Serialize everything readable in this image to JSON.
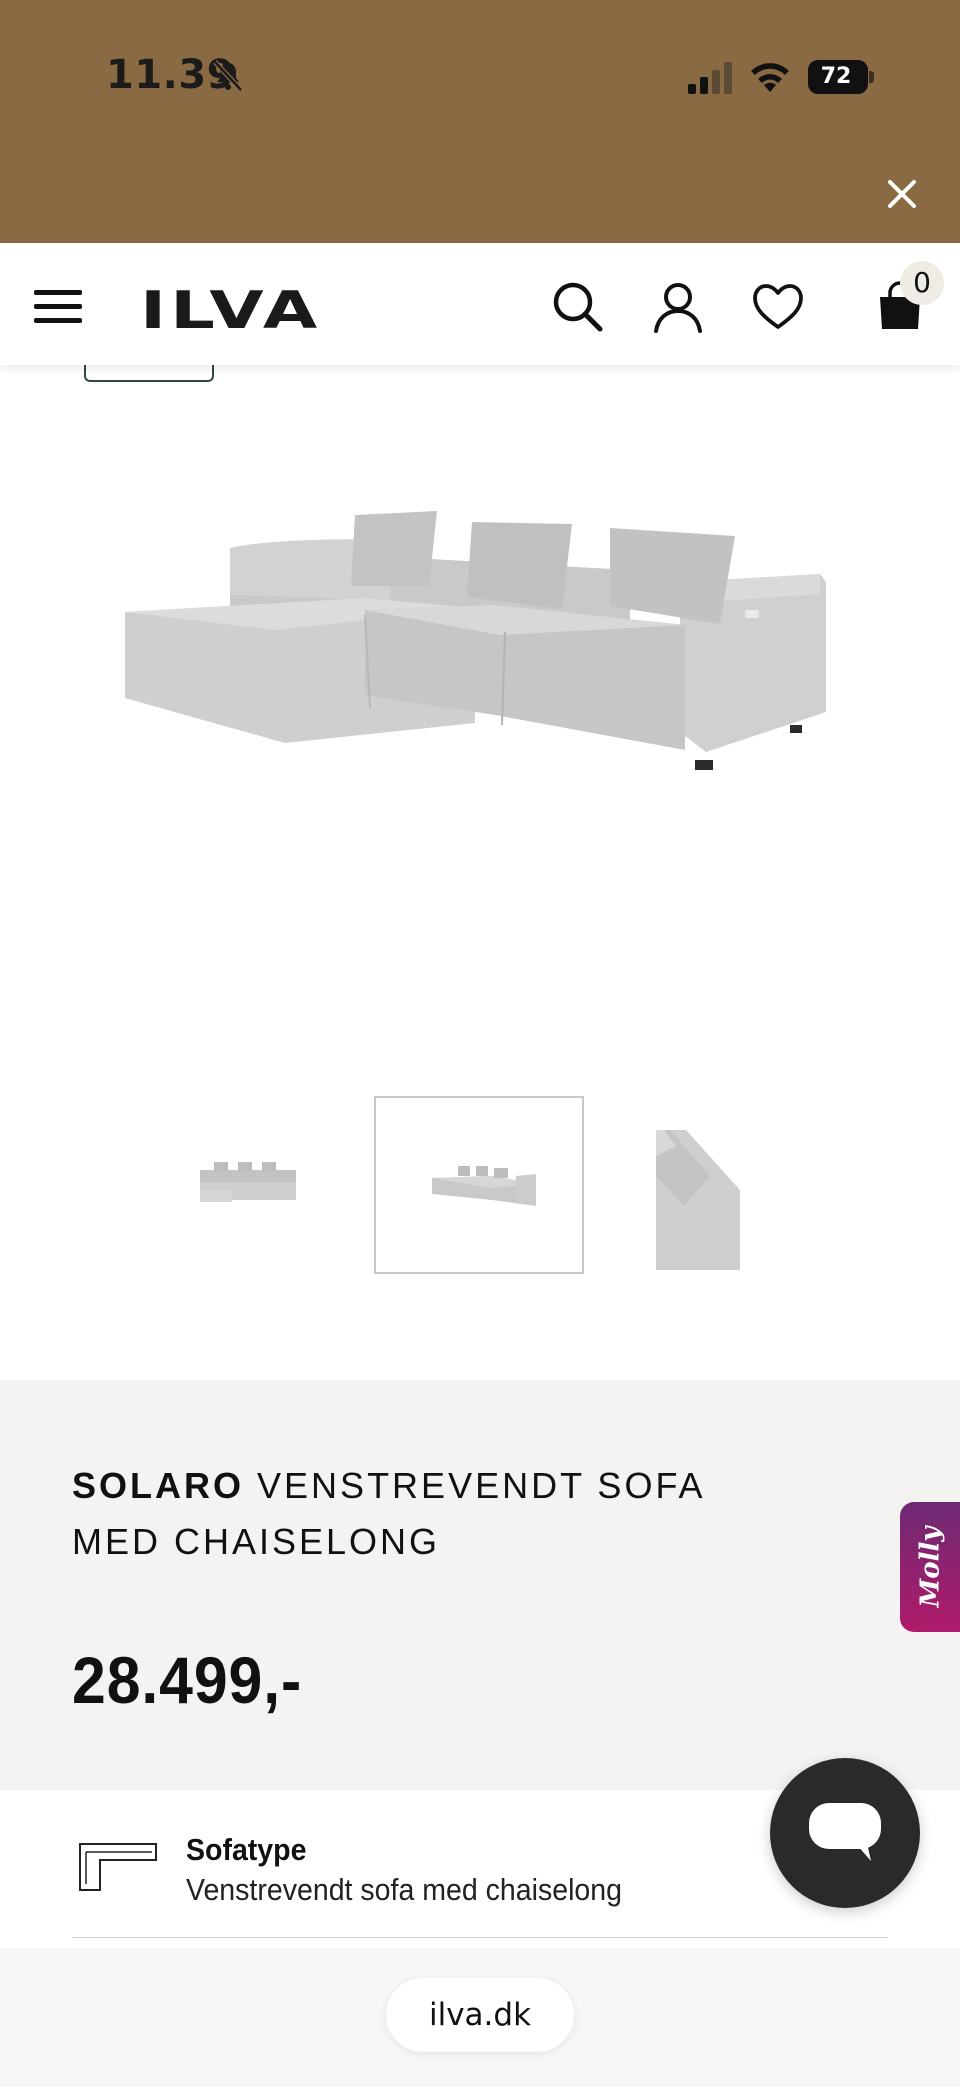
{
  "status_bar": {
    "time": "11.39",
    "battery": "72",
    "icons": [
      "bell-muted-icon",
      "signal-icon",
      "wifi-icon",
      "battery-icon"
    ]
  },
  "banner": {
    "background": "#8a6a43",
    "close_icon": "close-icon"
  },
  "header": {
    "logo": "ILVA",
    "icons": [
      "menu-icon",
      "search-icon",
      "user-icon",
      "heart-icon",
      "bag-icon"
    ],
    "cart_count": "0"
  },
  "gallery": {
    "main_image": "sofa-chaiselong-image",
    "thumbnails": [
      "sofa-front-thumbnail",
      "sofa-angle-thumbnail",
      "sofa-detail-thumbnail"
    ],
    "selected_thumbnail": 2
  },
  "product": {
    "brand": "SOLARO",
    "title": "VENSTREVENDT SOFA MED CHAISELONG",
    "price": "28.499,-"
  },
  "molly": {
    "label": "Molly"
  },
  "attributes": {
    "sofatype_label": "Sofatype",
    "sofatype_value": "Venstrevendt sofa med chaiselong"
  },
  "chat": {
    "icon": "chat-icon"
  },
  "browser": {
    "url": "ilva.dk"
  }
}
